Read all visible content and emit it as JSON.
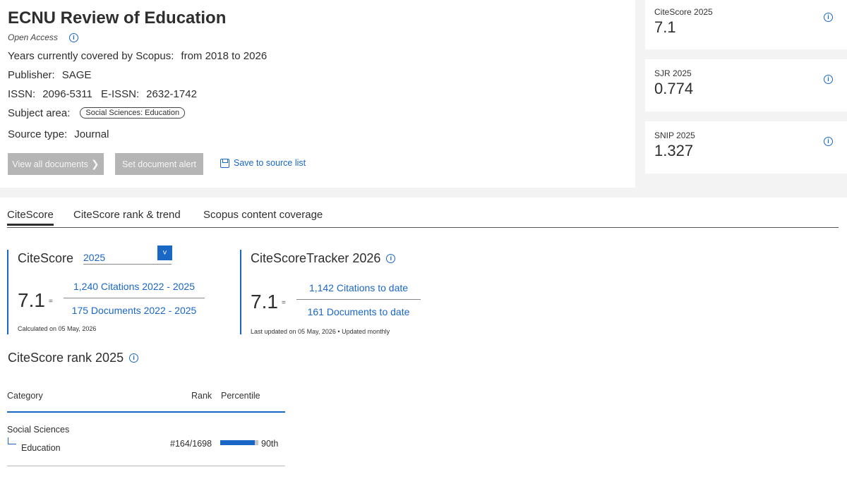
{
  "journal": {
    "title": "ECNU Review of Education",
    "open_access": "Open Access",
    "years_label": "Years currently covered by Scopus:",
    "years_value": "from 2018 to 2026",
    "publisher_label": "Publisher:",
    "publisher_value": "SAGE",
    "issn_label": "ISSN:",
    "issn_value": "2096-5311",
    "eissn_label": "E-ISSN:",
    "eissn_value": "2632-1742",
    "subject_label": "Subject area:",
    "subject_value": "Social Sciences: Education",
    "source_type_label": "Source type:",
    "source_type_value": "Journal"
  },
  "actions": {
    "view_all": "View all documents",
    "set_alert": "Set document alert",
    "save_to_list": "Save to source list"
  },
  "metrics": [
    {
      "label": "CiteScore 2025",
      "value": "7.1"
    },
    {
      "label": "SJR 2025",
      "value": "0.774"
    },
    {
      "label": "SNIP 2025",
      "value": "1.327"
    }
  ],
  "tabs": [
    "CiteScore",
    "CiteScore rank & trend",
    "Scopus content coverage"
  ],
  "citescore": {
    "title": "CiteScore",
    "year": "2025",
    "value": "7.1",
    "eq": "=",
    "numerator": "1,240 Citations 2022 - 2025",
    "denominator": "175 Documents 2022 - 2025",
    "note": "Calculated on 05 May, 2026"
  },
  "tracker": {
    "title": "CiteScoreTracker 2026",
    "value": "7.1",
    "eq": "=",
    "numerator": "1,142 Citations to date",
    "denominator": "161 Documents to date",
    "note": "Last updated on 05 May, 2026 • Updated monthly"
  },
  "rank": {
    "title": "CiteScore rank 2025",
    "headers": {
      "category": "Category",
      "rank": "Rank",
      "percentile": "Percentile"
    },
    "rows": [
      {
        "category": "Social Sciences",
        "subcategory": "Education",
        "rank": "#164/1698",
        "percentile": "90th",
        "percentile_value": 90
      }
    ]
  },
  "colors": {
    "accent": "#1a67c6",
    "disabled_button": "#b5b5b5"
  }
}
